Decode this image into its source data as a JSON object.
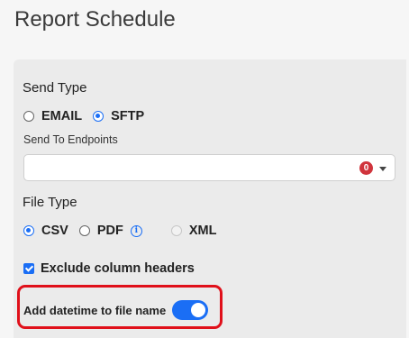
{
  "page": {
    "title": "Report Schedule"
  },
  "send_type": {
    "label": "Send Type",
    "options": [
      {
        "label": "EMAIL",
        "checked": false
      },
      {
        "label": "SFTP",
        "checked": true
      }
    ]
  },
  "send_to_endpoints": {
    "label": "Send To Endpoints",
    "value": "",
    "selected_count": "0"
  },
  "file_type": {
    "label": "File Type",
    "options": [
      {
        "label": "CSV",
        "checked": true,
        "disabled": false
      },
      {
        "label": "PDF",
        "checked": false,
        "disabled": false,
        "icon": "info-icon"
      },
      {
        "label": "XML",
        "checked": false,
        "disabled": true
      }
    ]
  },
  "exclude_headers": {
    "label": "Exclude column headers",
    "checked": true
  },
  "add_datetime": {
    "label": "Add datetime to file name",
    "enabled": true
  },
  "colors": {
    "accent": "#1a6ef5",
    "highlight": "#e0101a",
    "badge": "#d0343c"
  }
}
